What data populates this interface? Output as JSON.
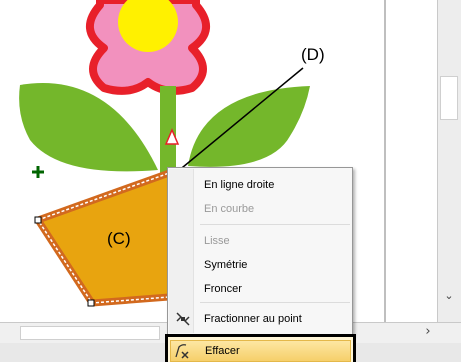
{
  "annotations": {
    "label_c": "(C)",
    "label_d": "(D)"
  },
  "context_menu": {
    "items": [
      {
        "label": "En ligne droite",
        "enabled": true
      },
      {
        "label": "En courbe",
        "enabled": false
      },
      {
        "label": "Lisse",
        "enabled": false
      },
      {
        "label": "Symétrie",
        "enabled": true
      },
      {
        "label": "Froncer",
        "enabled": true
      },
      {
        "label": "Fractionner au point",
        "enabled": true,
        "icon": "split-point-icon"
      },
      {
        "label": "Effacer",
        "enabled": true,
        "icon": "erase-point-icon",
        "highlighted": true
      }
    ]
  },
  "colors": {
    "petal": "#f291be",
    "petal_outline": "#e8202a",
    "flower_center": "#fff100",
    "leaf": "#74b72b",
    "pot_fill": "#e8a40f",
    "pot_outline": "#d2691e",
    "cursor": "#006400",
    "menu_highlight": "#f9d982"
  },
  "icons": {
    "cursor": "plus-cursor-icon",
    "vscroll_down": "⌄",
    "hscroll_right": "›"
  }
}
